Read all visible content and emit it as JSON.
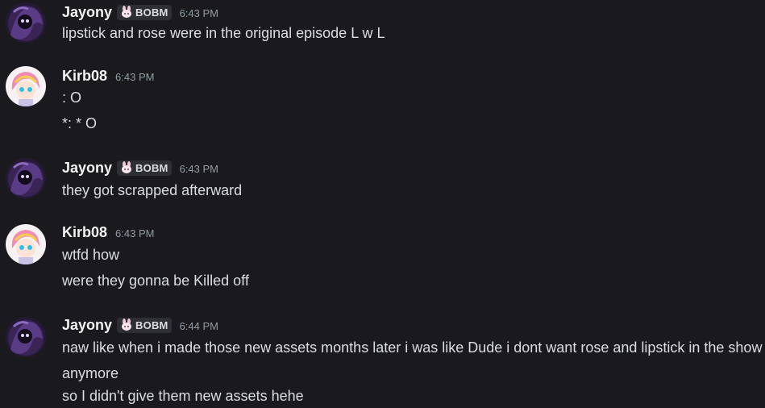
{
  "messages": [
    {
      "author": "Jayony",
      "tag": "BOBM",
      "time": "6:43 PM",
      "lines": [
        "lipstick and rose were in the original episode L w L"
      ]
    },
    {
      "author": "Kirb08",
      "time": "6:43 PM",
      "lines": [
        ": O",
        "*: * O"
      ]
    },
    {
      "author": "Jayony",
      "tag": "BOBM",
      "time": "6:43 PM",
      "lines": [
        "they got scrapped afterward"
      ]
    },
    {
      "author": "Kirb08",
      "time": "6:43 PM",
      "lines": [
        "wtfd how",
        "were they gonna be Killed off"
      ]
    },
    {
      "author": "Jayony",
      "tag": "BOBM",
      "time": "6:44 PM",
      "lines": [
        "naw like when i made those new assets months later i was like Dude i dont want rose and lipstick in the show anymore",
        "so I didn't give them new assets hehe"
      ]
    }
  ],
  "colors": {
    "background": "#1a1a1e",
    "username": "#f2f3f5",
    "text": "#dbdee1",
    "timestamp": "#949ba4",
    "tag_bg": "#2e2f35"
  },
  "icons": {
    "jayony_avatar": "purple-cloaked-character-avatar",
    "kirb08_avatar": "pink-haired-character-avatar",
    "tag_icon": "bunny-icon"
  }
}
